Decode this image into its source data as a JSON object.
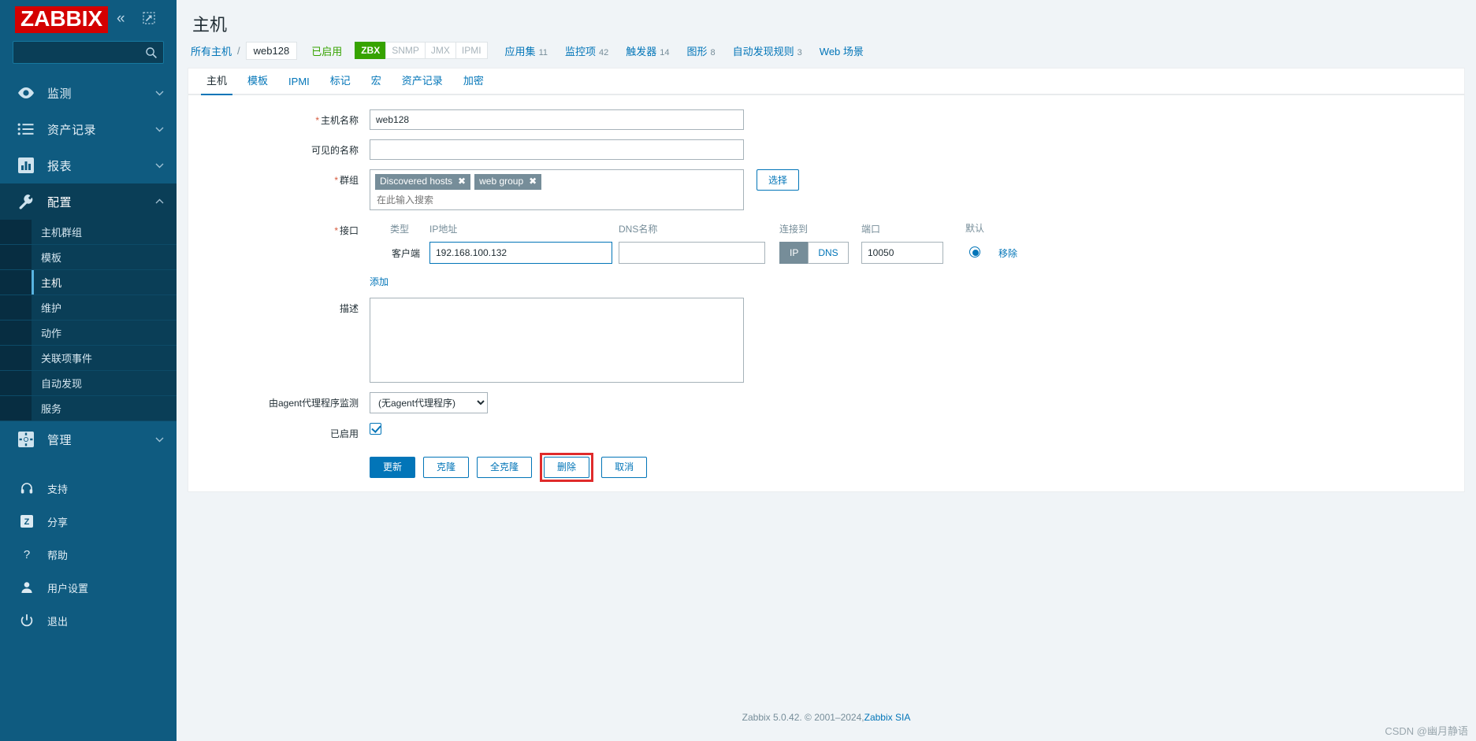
{
  "app": {
    "logo": "ZABBIX",
    "collapse_icon": "chevron-double-left-icon",
    "expand_icon": "expand-icon",
    "search_placeholder": ""
  },
  "sidebar": {
    "nav": [
      {
        "label": "监测",
        "icon": "eye-icon",
        "expanded": false
      },
      {
        "label": "资产记录",
        "icon": "list-icon",
        "expanded": false
      },
      {
        "label": "报表",
        "icon": "bar-chart-icon",
        "expanded": false
      },
      {
        "label": "配置",
        "icon": "wrench-icon",
        "expanded": true
      },
      {
        "label": "管理",
        "icon": "gear-icon",
        "expanded": false
      }
    ],
    "config_sub": [
      {
        "label": "主机群组",
        "current": false
      },
      {
        "label": "模板",
        "current": false
      },
      {
        "label": "主机",
        "current": true
      },
      {
        "label": "维护",
        "current": false
      },
      {
        "label": "动作",
        "current": false
      },
      {
        "label": "关联项事件",
        "current": false
      },
      {
        "label": "自动发现",
        "current": false
      },
      {
        "label": "服务",
        "current": false
      }
    ],
    "bottom": [
      {
        "label": "支持",
        "icon": "headset-icon"
      },
      {
        "label": "分享",
        "icon": "zabbix-share-icon"
      },
      {
        "label": "帮助",
        "icon": "question-icon"
      },
      {
        "label": "用户设置",
        "icon": "user-icon"
      },
      {
        "label": "退出",
        "icon": "power-icon"
      }
    ]
  },
  "header": {
    "title": "主机"
  },
  "breadcrumb": {
    "all_hosts": "所有主机",
    "separator": "/",
    "current": "web128",
    "status": "已启用",
    "protocols": [
      {
        "label": "ZBX",
        "active": true
      },
      {
        "label": "SNMP",
        "active": false
      },
      {
        "label": "JMX",
        "active": false
      },
      {
        "label": "IPMI",
        "active": false
      }
    ],
    "stats": [
      {
        "label": "应用集",
        "count": "11"
      },
      {
        "label": "监控项",
        "count": "42"
      },
      {
        "label": "触发器",
        "count": "14"
      },
      {
        "label": "图形",
        "count": "8"
      },
      {
        "label": "自动发现规则",
        "count": "3"
      },
      {
        "label": "Web 场景",
        "count": ""
      }
    ]
  },
  "tabs": [
    {
      "label": "主机",
      "selected": true
    },
    {
      "label": "模板",
      "selected": false
    },
    {
      "label": "IPMI",
      "selected": false
    },
    {
      "label": "标记",
      "selected": false
    },
    {
      "label": "宏",
      "selected": false
    },
    {
      "label": "资产记录",
      "selected": false
    },
    {
      "label": "加密",
      "selected": false
    }
  ],
  "form": {
    "hostname": {
      "label": "主机名称",
      "required": true,
      "value": "web128"
    },
    "visible_name": {
      "label": "可见的名称",
      "required": false,
      "value": "",
      "placeholder": ""
    },
    "groups": {
      "label": "群组",
      "required": true,
      "chips": [
        "Discovered hosts",
        "web group"
      ],
      "placeholder": "在此输入搜索",
      "select_button": "选择"
    },
    "interfaces": {
      "label": "接口",
      "required": true,
      "headers": {
        "type": "类型",
        "ip": "IP地址",
        "dns": "DNS名称",
        "connect_to": "连接到",
        "port": "端口",
        "default": "默认"
      },
      "rows": [
        {
          "type": "客户端",
          "ip": "192.168.100.132",
          "dns": "",
          "connect_to": [
            {
              "label": "IP",
              "selected": true
            },
            {
              "label": "DNS",
              "selected": false
            }
          ],
          "port": "10050",
          "is_default": true,
          "remove_label": "移除"
        }
      ],
      "add_label": "添加"
    },
    "description": {
      "label": "描述",
      "value": ""
    },
    "monitored_by_proxy": {
      "label": "由agent代理程序监测",
      "value": "(无agent代理程序)",
      "options": [
        "(无agent代理程序)"
      ]
    },
    "enabled": {
      "label": "已启用",
      "checked": true
    }
  },
  "actions": [
    {
      "label": "更新",
      "style": "primary",
      "highlighted": false
    },
    {
      "label": "克隆",
      "style": "default",
      "highlighted": false
    },
    {
      "label": "全克隆",
      "style": "default",
      "highlighted": false
    },
    {
      "label": "删除",
      "style": "default",
      "highlighted": true
    },
    {
      "label": "取消",
      "style": "default",
      "highlighted": false
    }
  ],
  "footer": {
    "text": "Zabbix 5.0.42. © 2001–2024, ",
    "link": "Zabbix SIA"
  },
  "watermark": "CSDN @幽月静语",
  "colors": {
    "brand_red": "#d40000",
    "sidebar": "#0f5b80",
    "accent": "#0275b8",
    "green": "#36a300",
    "highlight": "#e02b2b"
  }
}
